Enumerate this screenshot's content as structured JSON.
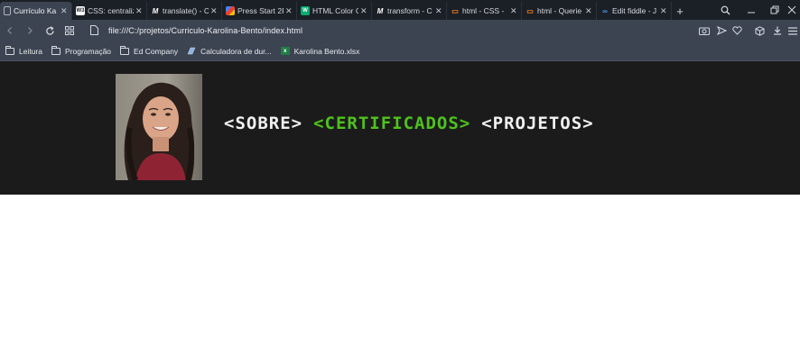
{
  "browser": {
    "tabs": [
      {
        "title": "Currículo Ka",
        "icon": "doc-icon",
        "active": true
      },
      {
        "title": "CSS: centraliz",
        "icon": "w3schools-icon",
        "active": false
      },
      {
        "title": "translate() - C",
        "icon": "mdn-icon",
        "active": false
      },
      {
        "title": "Press Start 2P",
        "icon": "google-fonts-icon",
        "active": false
      },
      {
        "title": "HTML Color C",
        "icon": "w3-icon",
        "active": false
      },
      {
        "title": "transform - C",
        "icon": "mdn-icon",
        "active": false
      },
      {
        "title": "html - CSS - ",
        "icon": "stackoverflow-icon",
        "active": false
      },
      {
        "title": "html - Querie",
        "icon": "stackoverflow-icon",
        "active": false
      },
      {
        "title": "Edit fiddle - J",
        "icon": "jsfiddle-icon",
        "active": false
      }
    ],
    "new_tab": "+",
    "url": "file:///C:/projetos/Curriculo-Karolina-Bento/index.html",
    "bookmarks": [
      {
        "label": "Leitura",
        "icon": "folder-icon"
      },
      {
        "label": "Programação",
        "icon": "folder-icon"
      },
      {
        "label": "Ed Company",
        "icon": "folder-icon"
      },
      {
        "label": "Calculadora de dur...",
        "icon": "calculator-icon"
      },
      {
        "label": "Karolina Bento.xlsx",
        "icon": "excel-icon"
      }
    ]
  },
  "page": {
    "nav": [
      {
        "label": "<SOBRE>",
        "active": false
      },
      {
        "label": "<CERTIFICADOS>",
        "active": true
      },
      {
        "label": "<PROJETOS>",
        "active": false
      }
    ],
    "colors": {
      "header_bg": "#1b1b1b",
      "nav_text": "#f1f1f1",
      "nav_active": "#4fc21c"
    }
  }
}
